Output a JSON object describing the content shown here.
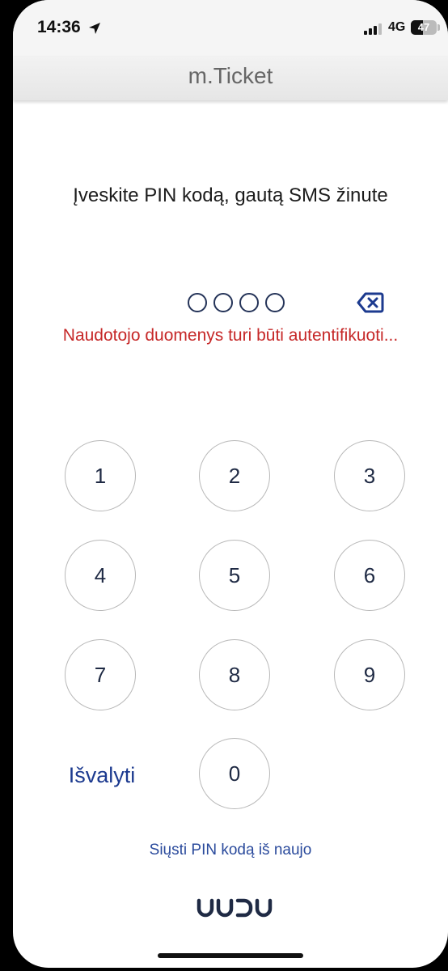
{
  "status_bar": {
    "time": "14:36",
    "network": "4G",
    "battery_level": "47",
    "battery_fraction": 0.47
  },
  "nav": {
    "title": "m.Ticket"
  },
  "pin_entry": {
    "instruction": "Įveskite PIN kodą, gautą SMS žinute",
    "digits_total": 4,
    "digits_entered": 0,
    "error_message": "Naudotojo duomenys turi būti autentifikuoti..."
  },
  "keypad": {
    "keys": [
      "1",
      "2",
      "3",
      "4",
      "5",
      "6",
      "7",
      "8",
      "9",
      "0"
    ],
    "clear_label": "Išvalyti"
  },
  "footer": {
    "resend_label": "Siųsti PIN kodą iš naujo",
    "logo_text": "JUDU"
  },
  "colors": {
    "accent": "#1c3a8f",
    "error": "#c62828",
    "dot_border": "#243358"
  },
  "icons": {
    "location": "location-arrow-icon",
    "signal": "cellular-signal-icon",
    "backspace": "backspace-icon"
  }
}
